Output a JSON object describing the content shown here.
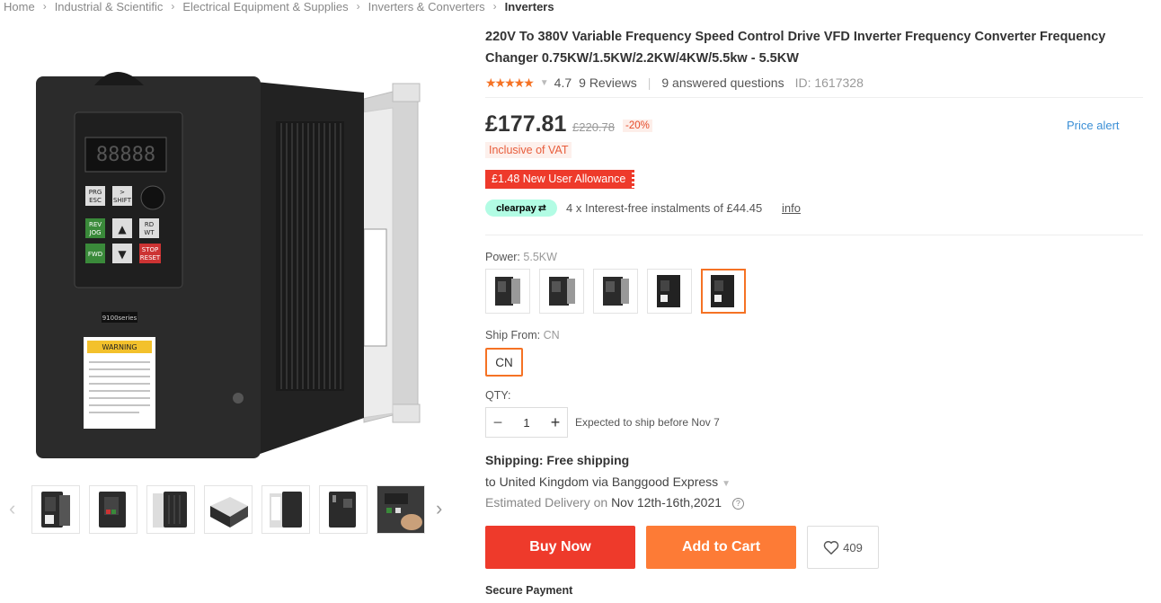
{
  "breadcrumb": [
    "Home",
    "Industrial & Scientific",
    "Electrical Equipment & Supplies",
    "Inverters & Converters",
    "Inverters"
  ],
  "product": {
    "title": "220V To 380V Variable Frequency Speed Control Drive VFD Inverter Frequency Converter Frequency Changer 0.75KW/1.5KW/2.2KW/4KW/5.5kw - 5.5KW",
    "rating": "4.7",
    "reviews": "9 Reviews",
    "answered": "9 answered questions",
    "id": "ID: 1617328"
  },
  "image_text": {
    "series": "9100series",
    "warning": "WARNING",
    "panel": [
      "PRG",
      "ESC",
      ">",
      "SHIFT",
      "REV",
      "JOG",
      "RD",
      "WT",
      "FWD",
      "STOP",
      "RESET"
    ]
  },
  "price": {
    "current": "£177.81",
    "original": "£220.78",
    "discount": "-20%",
    "alert": "Price alert",
    "vat": "Inclusive of VAT",
    "allowance": "£1.48 New User Allowance"
  },
  "clearpay": {
    "badge": "clearpay",
    "text": "4 x Interest-free instalments of £44.45",
    "info": "info"
  },
  "options": {
    "power_label": "Power:",
    "power_value": "5.5KW",
    "variant_count": 5,
    "selected_variant": 5,
    "ship_from_label": "Ship From:",
    "ship_from_value": "CN",
    "ship_option": "CN"
  },
  "qty": {
    "label": "QTY:",
    "value": "1",
    "minus": "−",
    "plus": "+",
    "expected": "Expected to ship before Nov 7"
  },
  "shipping": {
    "title": "Shipping: Free shipping",
    "to": "to United Kingdom via Banggood Express",
    "delivery_label": "Estimated Delivery on",
    "delivery_date": "Nov 12th-16th,2021"
  },
  "actions": {
    "buy_now": "Buy Now",
    "add_to_cart": "Add to Cart",
    "wishlist_count": "409"
  },
  "secure": "Secure Payment",
  "colors": {
    "accent": "#f57224",
    "buy": "#ee3a2b",
    "cart": "#fd7b36",
    "link": "#3b8fd6",
    "clearpay": "#b2fce4"
  }
}
